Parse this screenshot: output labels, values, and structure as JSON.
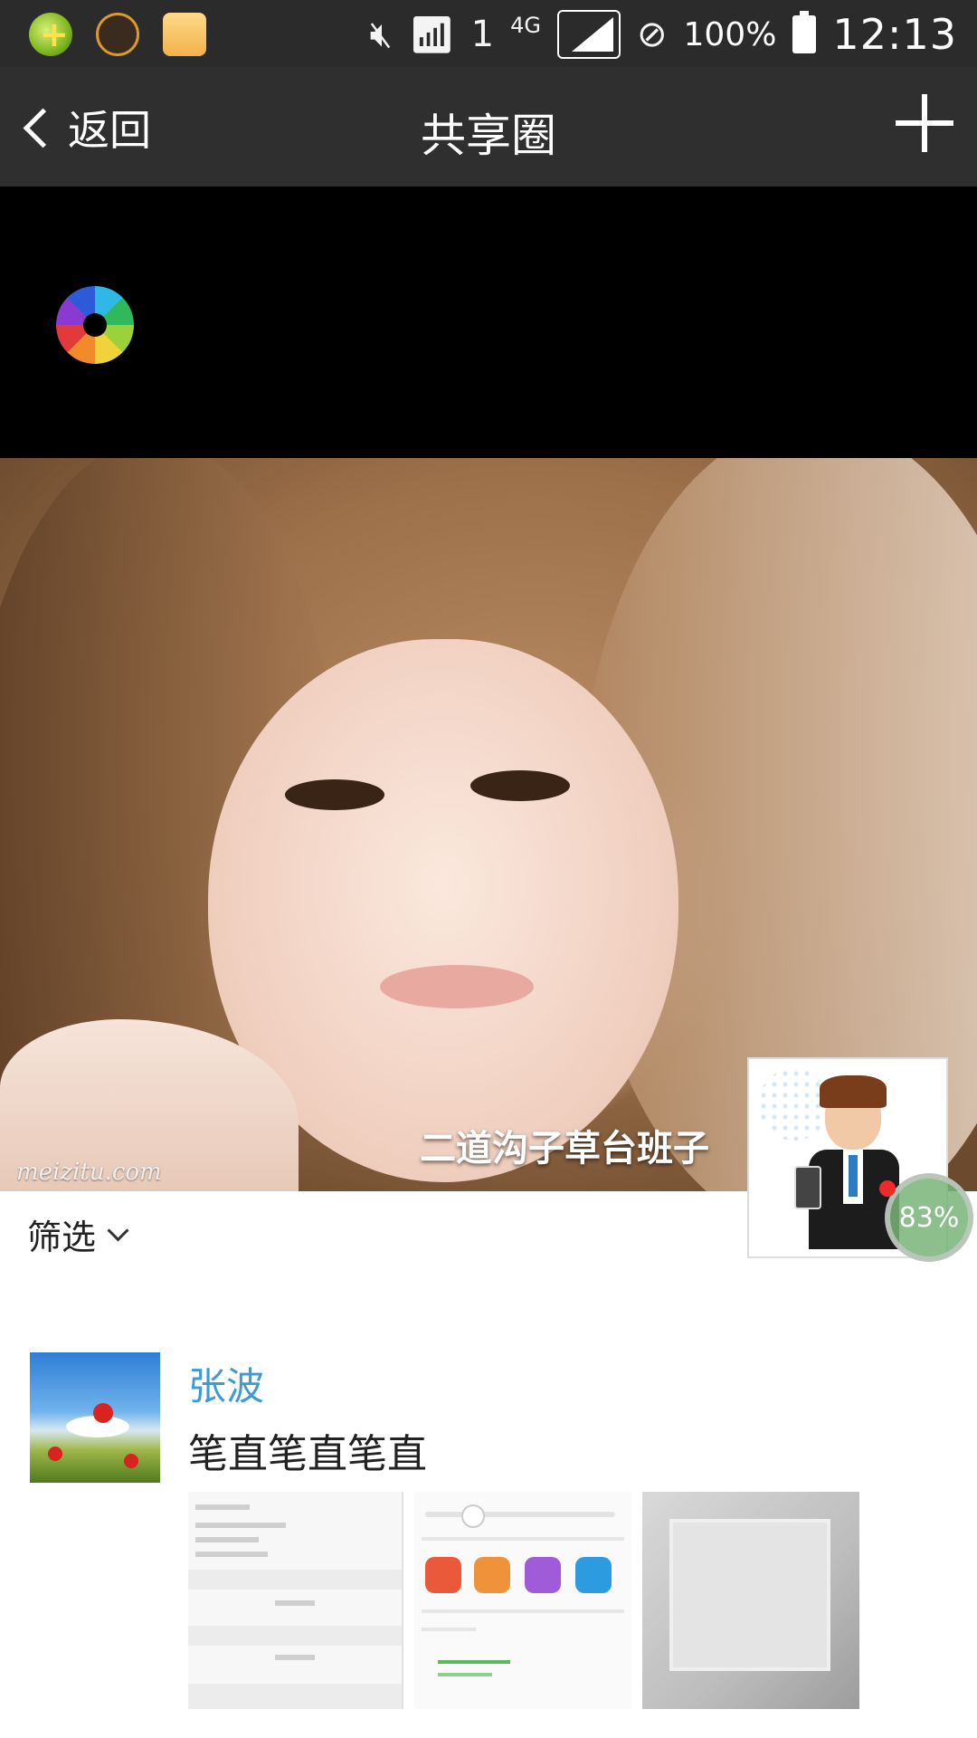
{
  "status_bar": {
    "network": "4G",
    "sim": "1",
    "battery_percent": "100%",
    "time": "12:13"
  },
  "title_bar": {
    "back_label": "返回",
    "title": "共享圈"
  },
  "cover": {
    "name": "二道沟子草台班子",
    "watermark": "meizitu.com"
  },
  "floating_progress": "83%",
  "filter": {
    "label": "筛选"
  },
  "post": {
    "author": "张波",
    "text": "笔直笔直笔直"
  }
}
